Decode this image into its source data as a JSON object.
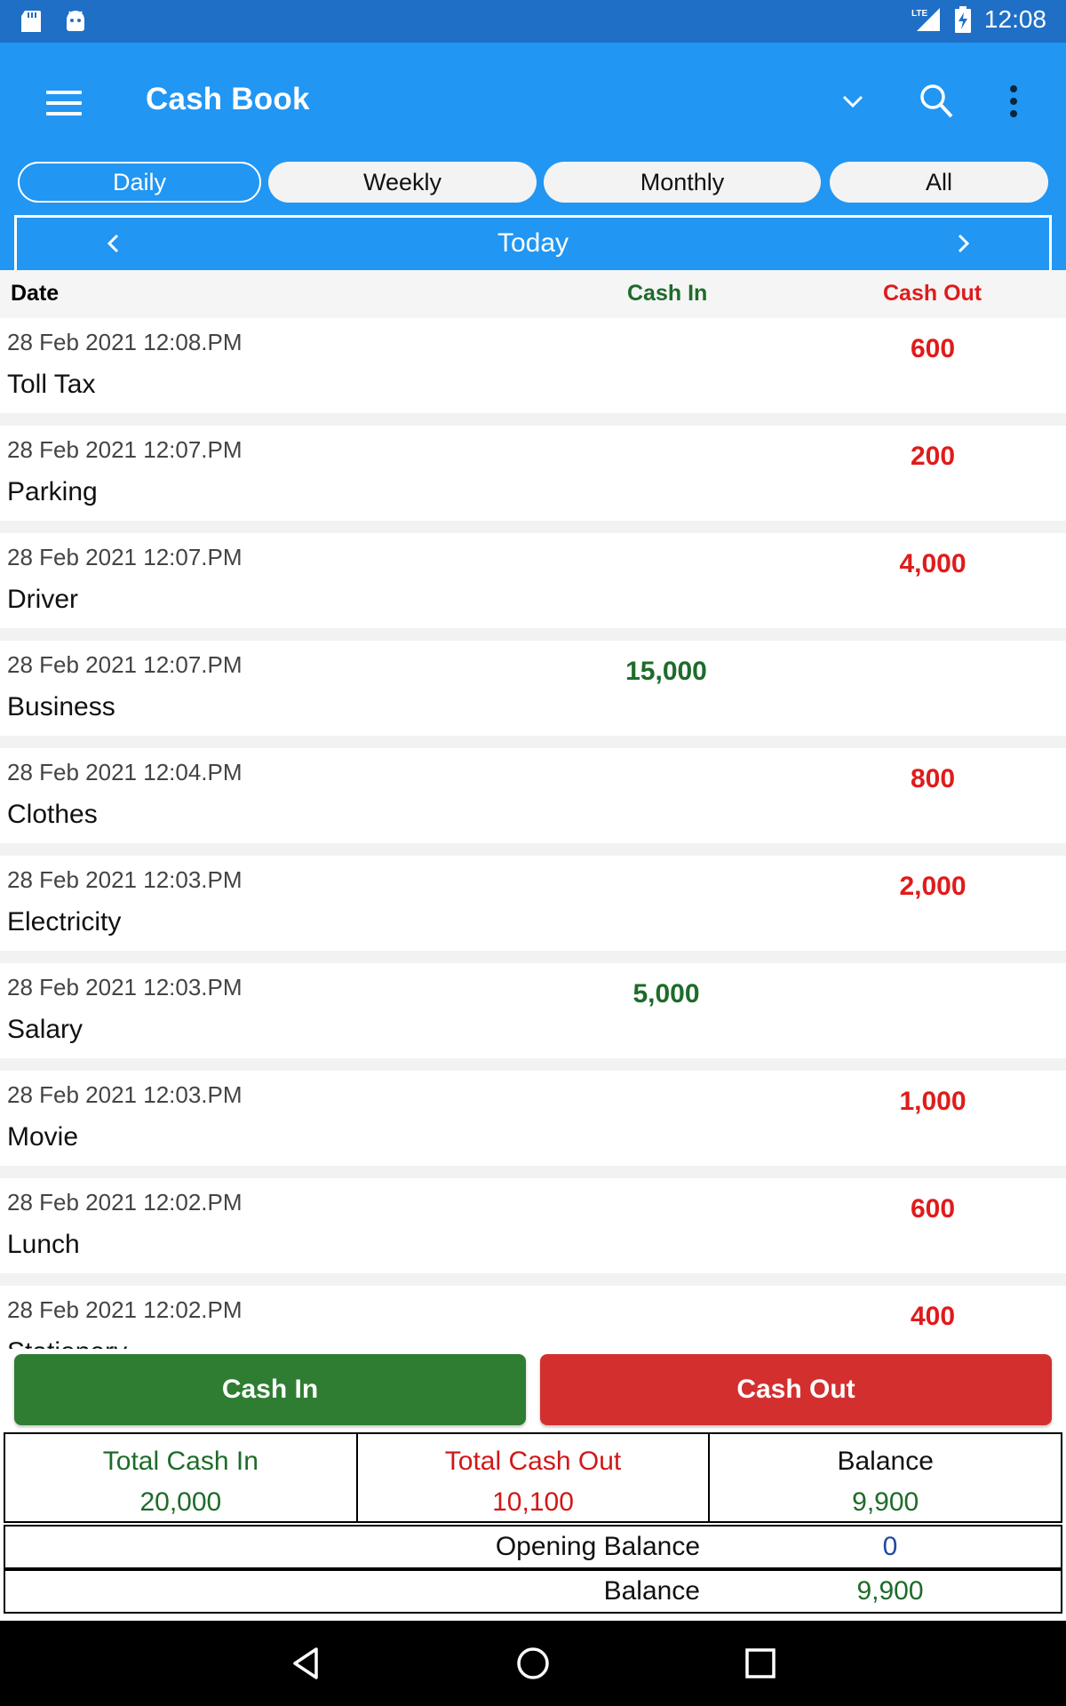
{
  "status_bar": {
    "time": "12:08",
    "network": "LTE",
    "icons": [
      "sd-card-icon",
      "android-icon",
      "signal-icon",
      "battery-charging-icon"
    ]
  },
  "app_bar": {
    "title": "Cash Book",
    "icons": [
      "menu-icon",
      "chevron-down-icon",
      "search-icon",
      "more-vert-icon"
    ]
  },
  "tabs": [
    {
      "label": "Daily",
      "active": true
    },
    {
      "label": "Weekly",
      "active": false
    },
    {
      "label": "Monthly",
      "active": false
    },
    {
      "label": "All",
      "active": false
    }
  ],
  "period": {
    "label": "Today"
  },
  "table": {
    "headers": {
      "date": "Date",
      "cash_in": "Cash In",
      "cash_out": "Cash Out"
    },
    "rows": [
      {
        "date": "28 Feb 2021 12:08.PM",
        "name": "Toll Tax",
        "cash_in": "",
        "cash_out": "600"
      },
      {
        "date": "28 Feb 2021 12:07.PM",
        "name": "Parking",
        "cash_in": "",
        "cash_out": "200"
      },
      {
        "date": "28 Feb 2021 12:07.PM",
        "name": "Driver",
        "cash_in": "",
        "cash_out": "4,000"
      },
      {
        "date": "28 Feb 2021 12:07.PM",
        "name": "Business",
        "cash_in": "15,000",
        "cash_out": ""
      },
      {
        "date": "28 Feb 2021 12:04.PM",
        "name": "Clothes",
        "cash_in": "",
        "cash_out": "800"
      },
      {
        "date": "28 Feb 2021 12:03.PM",
        "name": "Electricity",
        "cash_in": "",
        "cash_out": "2,000"
      },
      {
        "date": "28 Feb 2021 12:03.PM",
        "name": "Salary",
        "cash_in": "5,000",
        "cash_out": ""
      },
      {
        "date": "28 Feb 2021 12:03.PM",
        "name": "Movie",
        "cash_in": "",
        "cash_out": "1,000"
      },
      {
        "date": "28 Feb 2021 12:02.PM",
        "name": "Lunch",
        "cash_in": "",
        "cash_out": "600"
      },
      {
        "date": "28 Feb 2021 12:02.PM",
        "name": "Stationery",
        "cash_in": "",
        "cash_out": "400"
      }
    ]
  },
  "actions": {
    "cash_in": "Cash In",
    "cash_out": "Cash Out"
  },
  "totals": {
    "total_in_label": "Total Cash In",
    "total_in_value": "20,000",
    "total_out_label": "Total Cash Out",
    "total_out_value": "10,100",
    "balance_label": "Balance",
    "balance_value": "9,900"
  },
  "opening": {
    "label": "Opening Balance",
    "value": "0"
  },
  "closing": {
    "label": "Balance",
    "value": "9,900"
  },
  "nav_bar": {
    "icons": [
      "back-icon",
      "home-icon",
      "recents-icon"
    ]
  }
}
